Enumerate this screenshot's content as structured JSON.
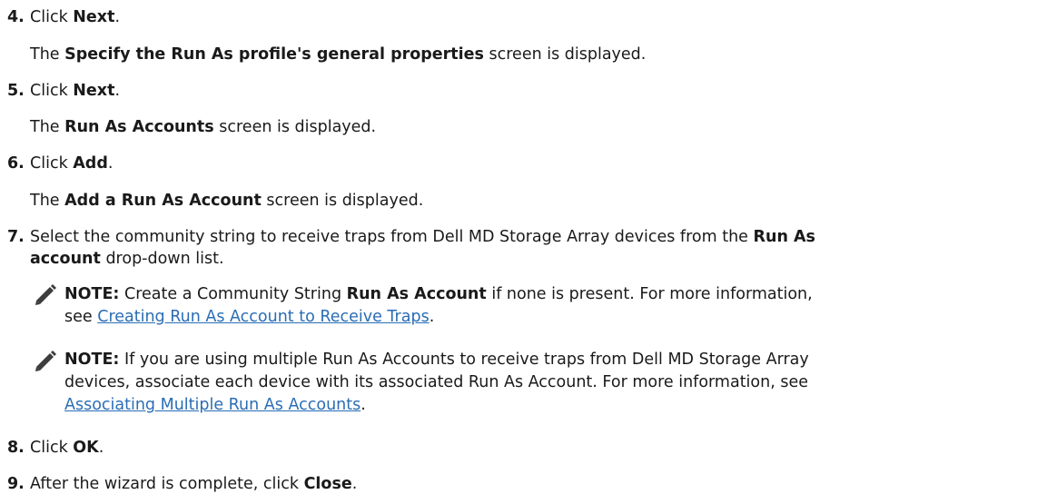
{
  "steps": [
    {
      "number": "4.",
      "parts": [
        "Click ",
        "Next",
        "."
      ],
      "result": [
        "The ",
        "Specify the Run As profile's general properties",
        " screen is displayed."
      ]
    },
    {
      "number": "5.",
      "parts": [
        "Click ",
        "Next",
        "."
      ],
      "result": [
        "The ",
        "Run As Accounts",
        " screen is displayed."
      ]
    },
    {
      "number": "6.",
      "parts": [
        "Click ",
        "Add",
        "."
      ],
      "result": [
        "The ",
        "Add a Run As Account",
        " screen is displayed."
      ]
    },
    {
      "number": "7.",
      "line1": [
        "Select the community string to receive traps from Dell MD Storage Array devices from the ",
        "Run As"
      ],
      "line2": [
        "account",
        " drop-down list."
      ]
    },
    {
      "number": "8.",
      "parts": [
        "Click ",
        "OK",
        "."
      ]
    },
    {
      "number": "9.",
      "parts": [
        "After the wizard is complete, click ",
        "Close",
        "."
      ]
    }
  ],
  "notes": [
    {
      "icon": "pencil-note-icon",
      "label": "NOTE:",
      "line1": [
        " Create a Community String ",
        "Run As Account",
        " if none is present. For more information,"
      ],
      "line2_prefix": "see ",
      "link": "Creating Run As Account to Receive Traps",
      "suffix": "."
    },
    {
      "icon": "pencil-note-icon",
      "label": "NOTE:",
      "line1": " If you are using multiple Run As Accounts to receive traps from Dell MD Storage Array",
      "line2": "devices, associate each device with its associated Run As Account. For more information, see",
      "link": "Associating Multiple Run As Accounts",
      "suffix": "."
    }
  ],
  "colors": {
    "text": "#1a1a1a",
    "link": "#2a6db5"
  }
}
